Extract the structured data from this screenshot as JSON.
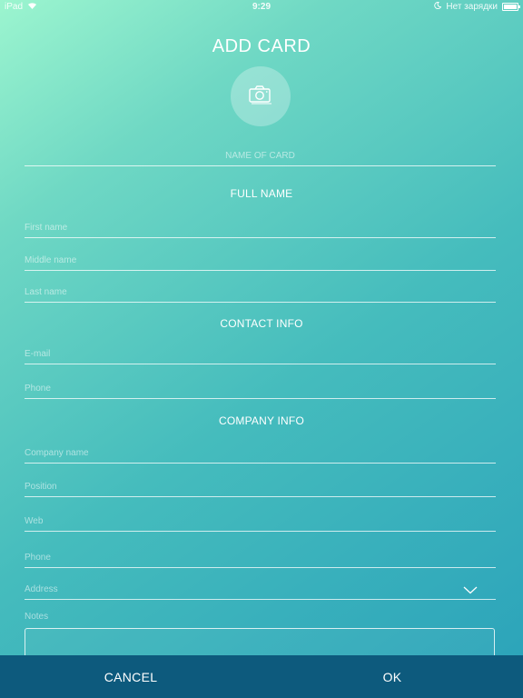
{
  "status_bar": {
    "device": "iPad",
    "time": "9:29",
    "battery_status": "Нет зарядки"
  },
  "title": "ADD CARD",
  "card_name": {
    "placeholder": "NAME OF CARD",
    "value": ""
  },
  "sections": {
    "full_name": {
      "title": "FULL NAME",
      "first_name": {
        "placeholder": "First name",
        "value": ""
      },
      "middle_name": {
        "placeholder": "Middle name",
        "value": ""
      },
      "last_name": {
        "placeholder": "Last name",
        "value": ""
      }
    },
    "contact_info": {
      "title": "CONTACT INFO",
      "email": {
        "placeholder": "E-mail",
        "value": ""
      },
      "phone": {
        "placeholder": "Phone",
        "value": ""
      }
    },
    "company_info": {
      "title": "COMPANY INFO",
      "company_name": {
        "placeholder": "Company name",
        "value": ""
      },
      "position": {
        "placeholder": "Position",
        "value": ""
      },
      "web": {
        "placeholder": "Web",
        "value": ""
      },
      "phone": {
        "placeholder": "Phone",
        "value": ""
      },
      "address": {
        "placeholder": "Address",
        "value": ""
      }
    }
  },
  "notes": {
    "label": "Notes",
    "value": ""
  },
  "actions": {
    "cancel": "CANCEL",
    "ok": "OK"
  },
  "icons": {
    "photo": "camera-icon",
    "address_expand": "chevron-down-icon",
    "wifi": "wifi-icon",
    "moon": "moon-icon",
    "battery": "battery-icon"
  },
  "colors": {
    "gradient_start": "#9cf5cf",
    "gradient_end": "#2aa2ba",
    "bottom_bar": "#0d5a7d"
  }
}
